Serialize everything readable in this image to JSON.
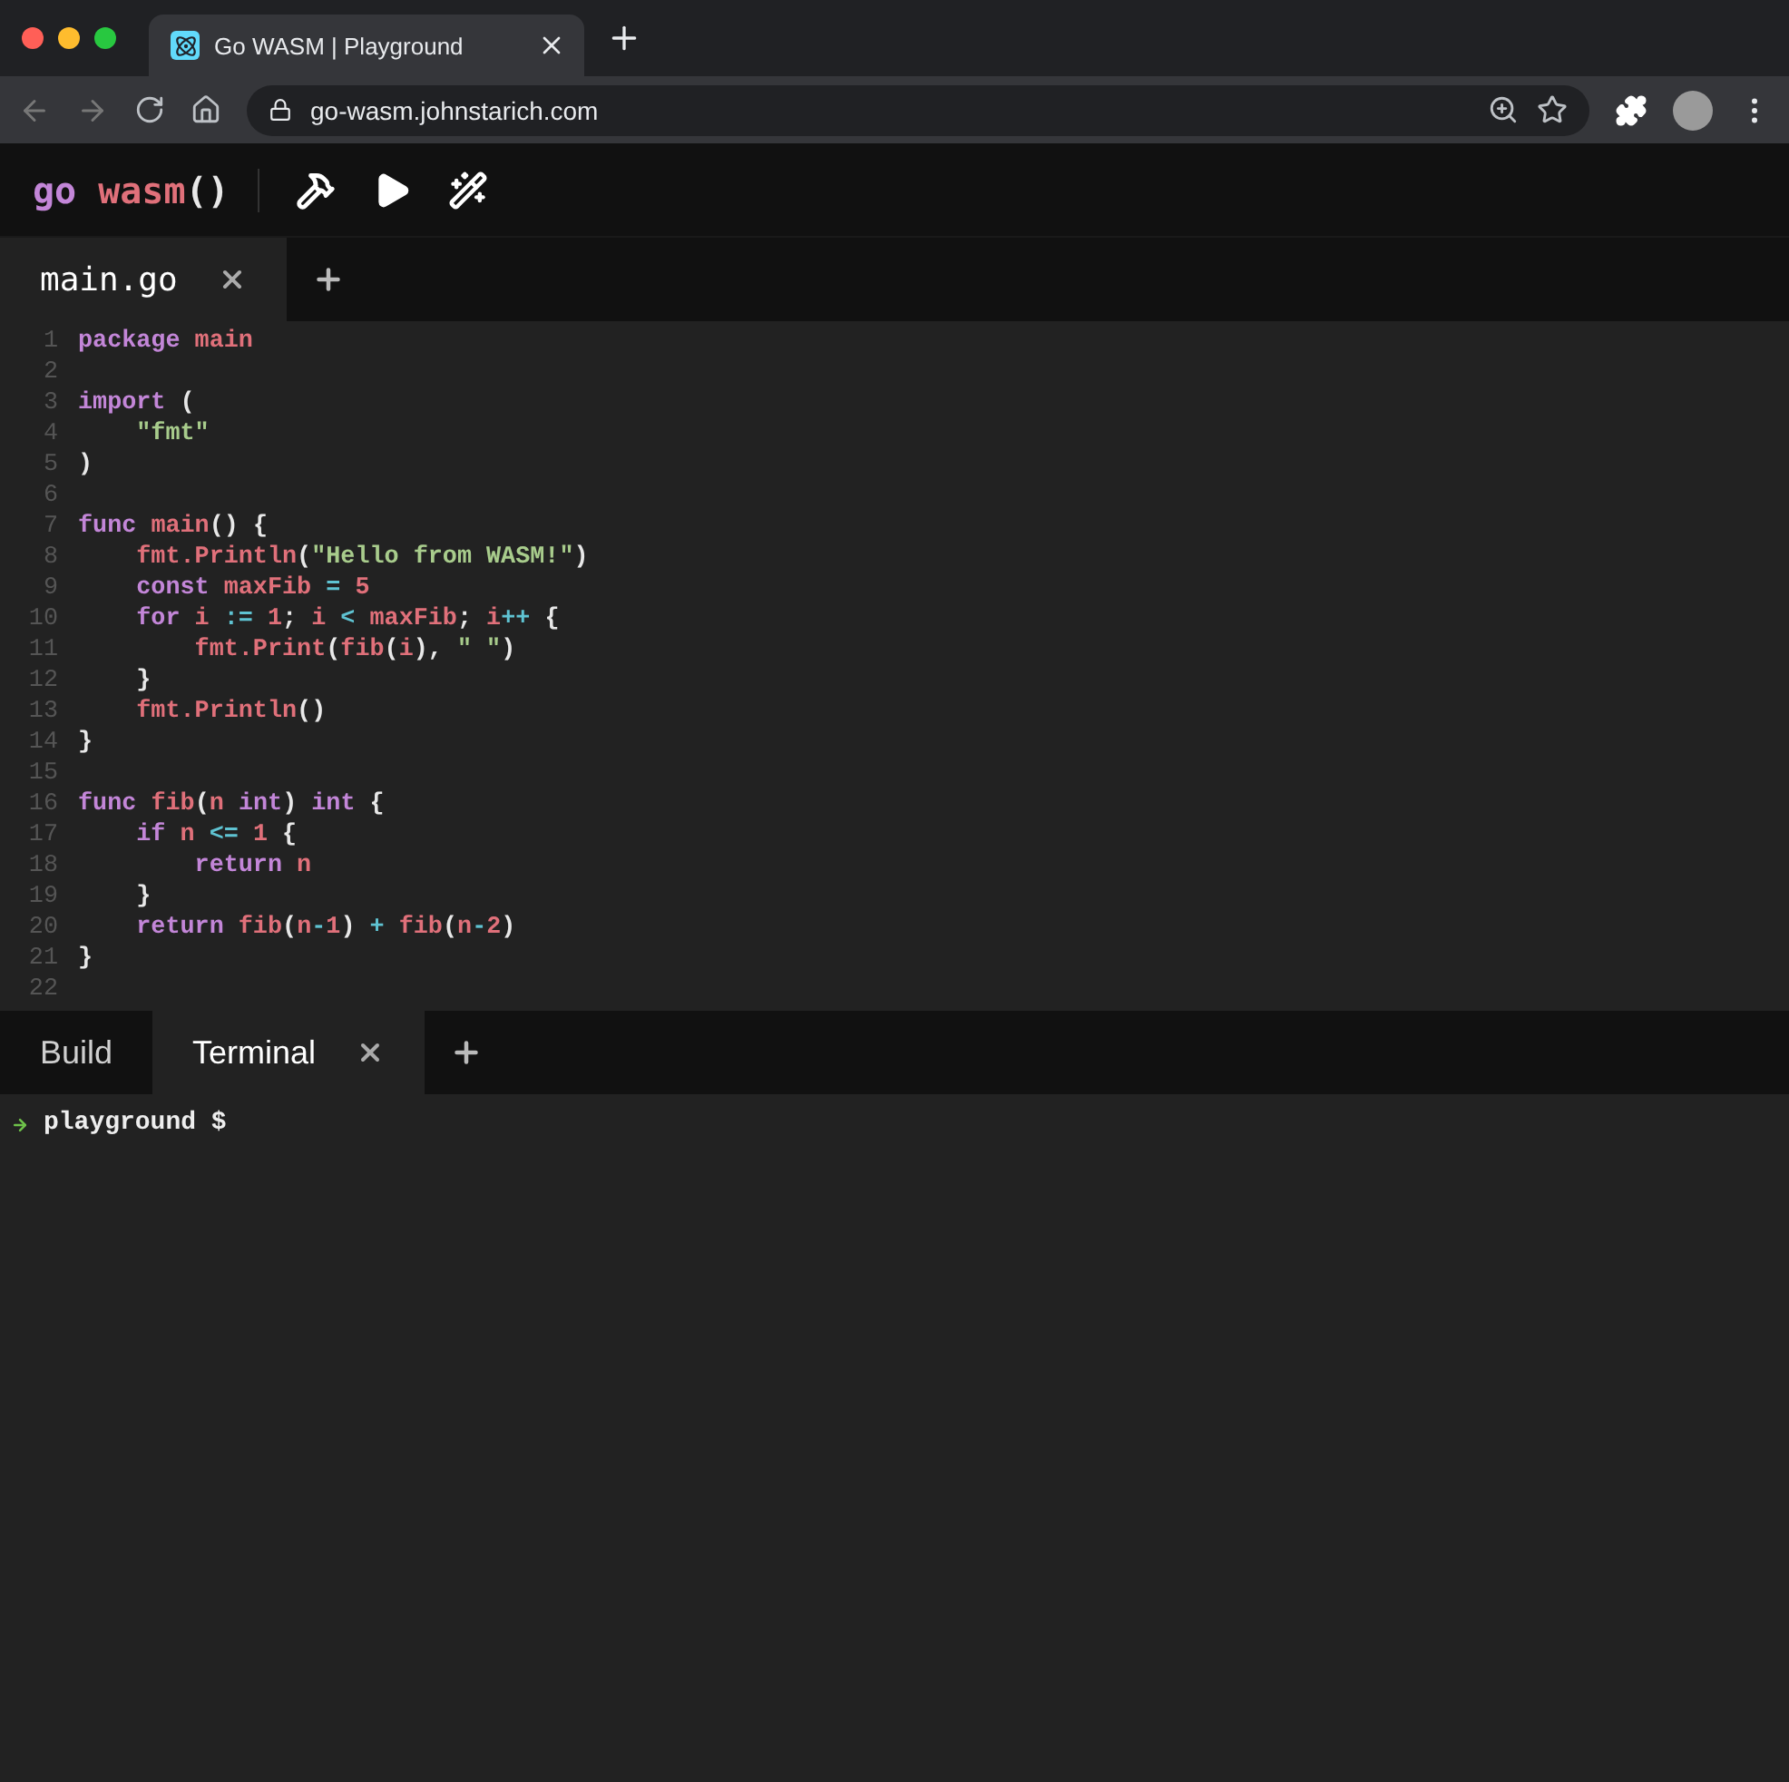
{
  "browser": {
    "tab_title": "Go WASM | Playground",
    "url": "go-wasm.johnstarich.com"
  },
  "app": {
    "logo": [
      {
        "text": "go",
        "kind": "keyword"
      },
      {
        "text": "wasm",
        "kind": "ident"
      },
      {
        "text": "()",
        "kind": "punct"
      }
    ]
  },
  "editor_tabs": [
    {
      "label": "main.go",
      "selected": true,
      "closable": true
    }
  ],
  "editor": {
    "lines": [
      {
        "n": "1",
        "tokens": [
          {
            "text": "package",
            "kind": "keyword"
          },
          {
            "text": " main",
            "kind": "ident"
          }
        ]
      },
      {
        "n": "2"
      },
      {
        "n": "3",
        "tokens": [
          {
            "text": "import",
            "kind": "keyword"
          },
          {
            "text": " (",
            "kind": "punct"
          }
        ]
      },
      {
        "n": "4",
        "tokens": [
          {
            "text": "    \"fmt\"",
            "kind": "string"
          }
        ]
      },
      {
        "n": "5",
        "tokens": [
          {
            "text": ")",
            "kind": "punct"
          }
        ]
      },
      {
        "n": "6"
      },
      {
        "n": "7",
        "tokens": [
          {
            "text": "func",
            "kind": "keyword"
          },
          {
            "text": " main",
            "kind": "ident"
          },
          {
            "text": "() {",
            "kind": "punct"
          }
        ]
      },
      {
        "n": "8",
        "tokens": [
          {
            "text": "    fmt.Println",
            "kind": "ident"
          },
          {
            "text": "(",
            "kind": "punct"
          },
          {
            "text": "\"Hello from WASM!\"",
            "kind": "string"
          },
          {
            "text": ")",
            "kind": "punct"
          }
        ]
      },
      {
        "n": "9",
        "tokens": [
          {
            "text": "    const",
            "kind": "keyword"
          },
          {
            "text": " maxFib",
            "kind": "ident"
          },
          {
            "text": " =",
            "kind": "operator"
          },
          {
            "text": " 5",
            "kind": "number"
          }
        ]
      },
      {
        "n": "10",
        "tokens": [
          {
            "text": "    for",
            "kind": "keyword"
          },
          {
            "text": " i",
            "kind": "ident"
          },
          {
            "text": " :=",
            "kind": "operator"
          },
          {
            "text": " 1",
            "kind": "number"
          },
          {
            "text": ";",
            "kind": "punct"
          },
          {
            "text": " i",
            "kind": "ident"
          },
          {
            "text": " <",
            "kind": "operator"
          },
          {
            "text": " maxFib",
            "kind": "ident"
          },
          {
            "text": ";",
            "kind": "punct"
          },
          {
            "text": " i",
            "kind": "ident"
          },
          {
            "text": "++",
            "kind": "operator"
          },
          {
            "text": " {",
            "kind": "punct"
          }
        ]
      },
      {
        "n": "11",
        "tokens": [
          {
            "text": "        fmt.Print",
            "kind": "ident"
          },
          {
            "text": "(",
            "kind": "punct"
          },
          {
            "text": "fib",
            "kind": "ident"
          },
          {
            "text": "(",
            "kind": "punct"
          },
          {
            "text": "i",
            "kind": "ident"
          },
          {
            "text": "), ",
            "kind": "punct"
          },
          {
            "text": "\" \"",
            "kind": "string"
          },
          {
            "text": ")",
            "kind": "punct"
          }
        ]
      },
      {
        "n": "12",
        "tokens": [
          {
            "text": "    }",
            "kind": "punct"
          }
        ]
      },
      {
        "n": "13",
        "tokens": [
          {
            "text": "    fmt.Println",
            "kind": "ident"
          },
          {
            "text": "()",
            "kind": "punct"
          }
        ]
      },
      {
        "n": "14",
        "tokens": [
          {
            "text": "}",
            "kind": "punct"
          }
        ]
      },
      {
        "n": "15"
      },
      {
        "n": "16",
        "tokens": [
          {
            "text": "func",
            "kind": "keyword"
          },
          {
            "text": " fib",
            "kind": "ident"
          },
          {
            "text": "(",
            "kind": "punct"
          },
          {
            "text": "n",
            "kind": "ident"
          },
          {
            "text": " int",
            "kind": "keyword"
          },
          {
            "text": ")",
            "kind": "punct"
          },
          {
            "text": " int",
            "kind": "keyword"
          },
          {
            "text": " {",
            "kind": "punct"
          }
        ]
      },
      {
        "n": "17",
        "tokens": [
          {
            "text": "    if",
            "kind": "keyword"
          },
          {
            "text": " n",
            "kind": "ident"
          },
          {
            "text": " <=",
            "kind": "operator"
          },
          {
            "text": " 1",
            "kind": "number"
          },
          {
            "text": " {",
            "kind": "punct"
          }
        ]
      },
      {
        "n": "18",
        "tokens": [
          {
            "text": "        return",
            "kind": "keyword"
          },
          {
            "text": " n",
            "kind": "ident"
          }
        ]
      },
      {
        "n": "19",
        "tokens": [
          {
            "text": "    }",
            "kind": "punct"
          }
        ]
      },
      {
        "n": "20",
        "tokens": [
          {
            "text": "    return",
            "kind": "keyword"
          },
          {
            "text": " fib",
            "kind": "ident"
          },
          {
            "text": "(",
            "kind": "punct"
          },
          {
            "text": "n",
            "kind": "ident"
          },
          {
            "text": "-",
            "kind": "operator"
          },
          {
            "text": "1",
            "kind": "number"
          },
          {
            "text": ")",
            "kind": "punct"
          },
          {
            "text": " +",
            "kind": "operator"
          },
          {
            "text": " fib",
            "kind": "ident"
          },
          {
            "text": "(",
            "kind": "punct"
          },
          {
            "text": "n",
            "kind": "ident"
          },
          {
            "text": "-",
            "kind": "operator"
          },
          {
            "text": "2",
            "kind": "number"
          },
          {
            "text": ")",
            "kind": "punct"
          }
        ]
      },
      {
        "n": "21",
        "tokens": [
          {
            "text": "}",
            "kind": "punct"
          }
        ]
      },
      {
        "n": "22"
      }
    ]
  },
  "panel_tabs": [
    {
      "label": "Build",
      "selected": false,
      "closable": false
    },
    {
      "label": "Terminal",
      "selected": true,
      "closable": true
    }
  ],
  "terminal": {
    "prompt": "playground $"
  }
}
